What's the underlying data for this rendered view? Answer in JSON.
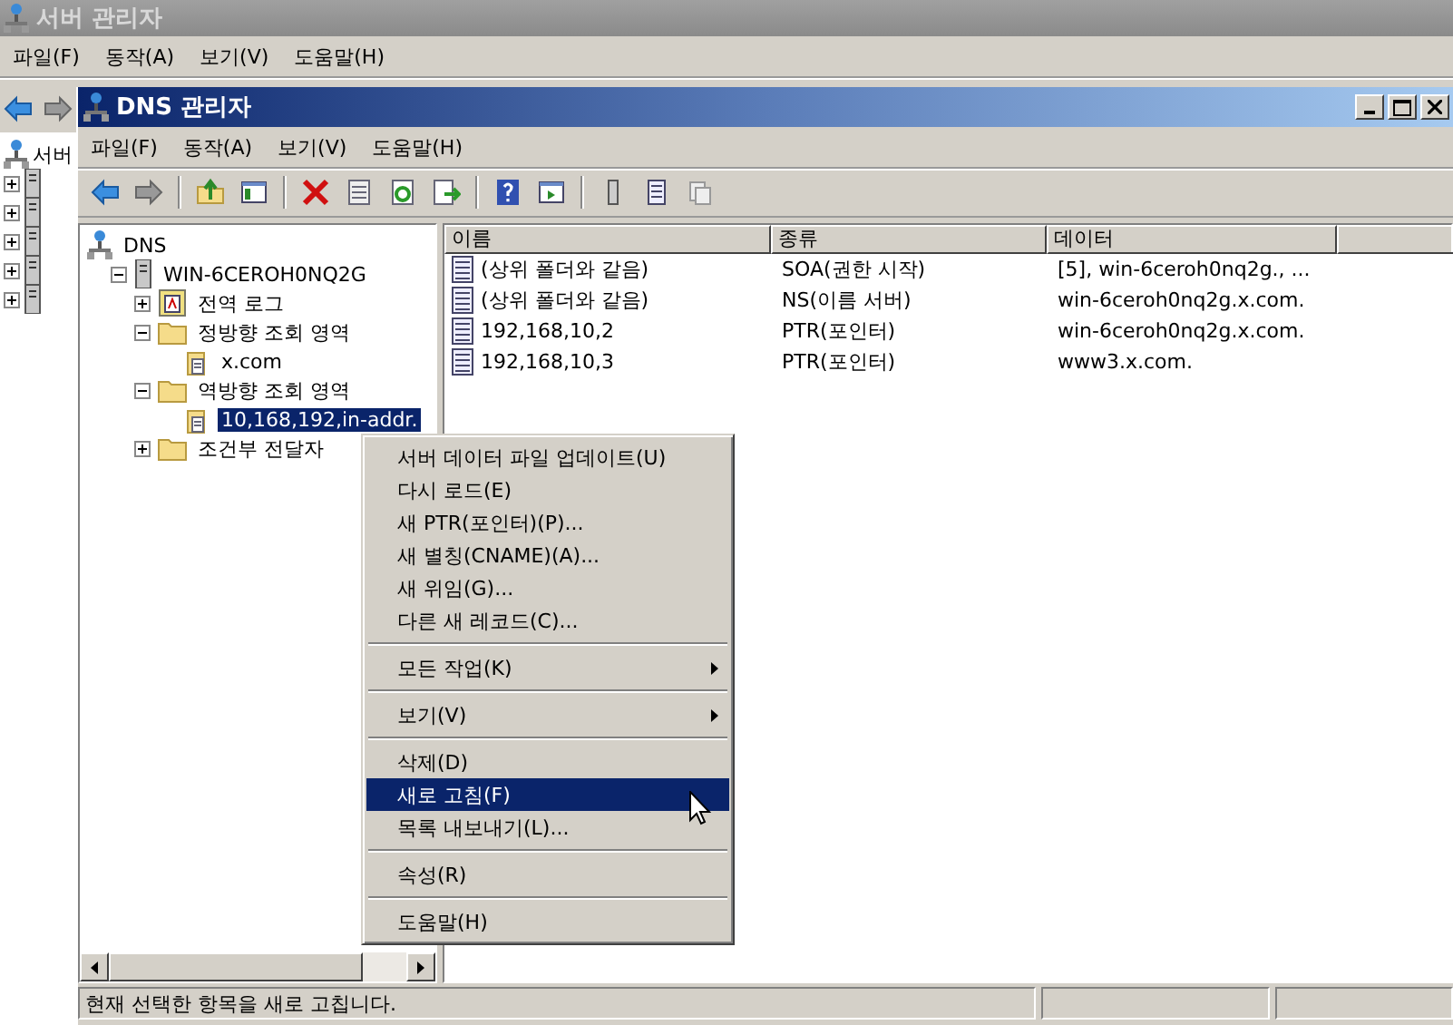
{
  "outer_window": {
    "title": "서버 관리자",
    "menu": [
      "파일(F)",
      "동작(A)",
      "보기(V)",
      "도움말(H)"
    ],
    "side_tree": [
      {
        "label": "서버"
      },
      {
        "expanded": false
      },
      {
        "expanded": false
      },
      {
        "expanded": false
      },
      {
        "expanded": false
      },
      {
        "expanded": false
      }
    ]
  },
  "window": {
    "title": "DNS 관리자",
    "menu": [
      "파일(F)",
      "동작(A)",
      "보기(V)",
      "도움말(H)"
    ]
  },
  "tree": [
    {
      "label": "DNS",
      "kind": "dns",
      "selected": false,
      "children": [
        {
          "label": "WIN-6CEROH0NQ2G",
          "kind": "server",
          "expanded": true,
          "selected": false,
          "children": [
            {
              "label": "전역 로그",
              "kind": "log",
              "expanded": false,
              "selected": false
            },
            {
              "label": "정방향 조회 영역",
              "kind": "folder",
              "expanded": true,
              "selected": false,
              "children": [
                {
                  "label": "x.com",
                  "kind": "zone",
                  "selected": false
                }
              ]
            },
            {
              "label": "역방향 조회 영역",
              "kind": "folder",
              "expanded": true,
              "selected": false,
              "children": [
                {
                  "label": "10,168,192,in-addr.",
                  "kind": "zone",
                  "selected": true
                }
              ]
            },
            {
              "label": "조건부 전달자",
              "kind": "folder",
              "expanded": false,
              "selected": false
            }
          ]
        }
      ]
    }
  ],
  "table": {
    "columns": [
      "이름",
      "종류",
      "데이터"
    ],
    "rows": [
      {
        "name": "(상위 폴더와 같음)",
        "type": "SOA(권한 시작)",
        "data": "[5], win-6ceroh0nq2g., ..."
      },
      {
        "name": "(상위 폴더와 같음)",
        "type": "NS(이름 서버)",
        "data": "win-6ceroh0nq2g.x.com."
      },
      {
        "name": "192,168,10,2",
        "type": "PTR(포인터)",
        "data": "win-6ceroh0nq2g.x.com."
      },
      {
        "name": "192,168,10,3",
        "type": "PTR(포인터)",
        "data": "www3.x.com."
      }
    ]
  },
  "context_menu": {
    "groups": [
      [
        {
          "label": "서버 데이터 파일 업데이트(U)",
          "submenu": false,
          "selected": false
        },
        {
          "label": "다시 로드(E)",
          "submenu": false,
          "selected": false
        },
        {
          "label": "새 PTR(포인터)(P)...",
          "submenu": false,
          "selected": false
        },
        {
          "label": "새 별칭(CNAME)(A)...",
          "submenu": false,
          "selected": false
        },
        {
          "label": "새 위임(G)...",
          "submenu": false,
          "selected": false
        },
        {
          "label": "다른 새 레코드(C)...",
          "submenu": false,
          "selected": false
        }
      ],
      [
        {
          "label": "모든 작업(K)",
          "submenu": true,
          "selected": false
        }
      ],
      [
        {
          "label": "보기(V)",
          "submenu": true,
          "selected": false
        }
      ],
      [
        {
          "label": "삭제(D)",
          "submenu": false,
          "selected": false
        },
        {
          "label": "새로 고침(F)",
          "submenu": false,
          "selected": true
        },
        {
          "label": "목록 내보내기(L)...",
          "submenu": false,
          "selected": false
        }
      ],
      [
        {
          "label": "속성(R)",
          "submenu": false,
          "selected": false
        }
      ],
      [
        {
          "label": "도움말(H)",
          "submenu": false,
          "selected": false
        }
      ]
    ]
  },
  "status_bar": {
    "text": "현재 선택한 항목을 새로 고칩니다."
  }
}
